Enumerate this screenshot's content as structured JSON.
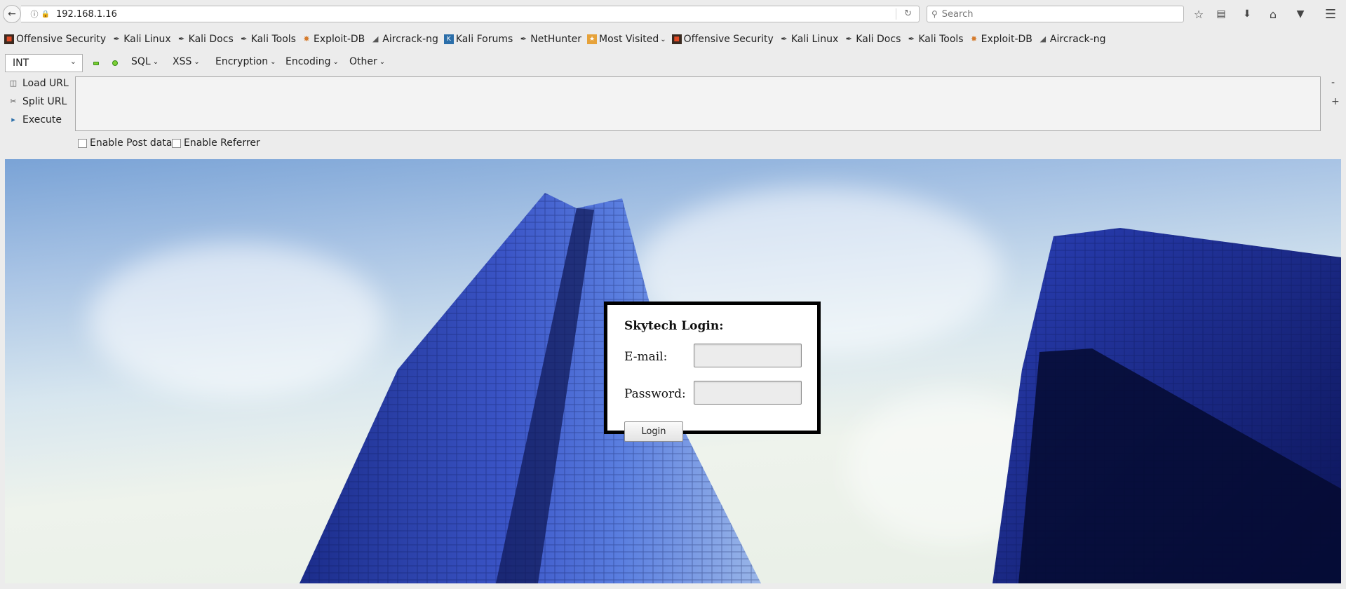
{
  "browser": {
    "url": "192.168.1.16",
    "search_placeholder": "Search",
    "icons": [
      "back-arrow-icon",
      "info-icon",
      "insecure-lock-icon",
      "reload-icon",
      "search-icon",
      "bookmark-star-icon",
      "reading-list-icon",
      "download-icon",
      "home-icon",
      "pocket-icon",
      "hamburger-menu-icon"
    ]
  },
  "bookmarks": [
    {
      "label": "Offensive Security",
      "icon": "offensive-security-icon"
    },
    {
      "label": "Kali Linux",
      "icon": "kali-dragon-icon"
    },
    {
      "label": "Kali Docs",
      "icon": "kali-dragon-icon"
    },
    {
      "label": "Kali Tools",
      "icon": "kali-dragon-icon"
    },
    {
      "label": "Exploit-DB",
      "icon": "exploit-db-icon"
    },
    {
      "label": "Aircrack-ng",
      "icon": "aircrack-icon"
    },
    {
      "label": "Kali Forums",
      "icon": "kali-forums-icon"
    },
    {
      "label": "NetHunter",
      "icon": "kali-dragon-icon"
    },
    {
      "label": "Most Visited",
      "icon": "most-visited-icon"
    },
    {
      "label": "Offensive Security",
      "icon": "offensive-security-icon"
    },
    {
      "label": "Kali Linux",
      "icon": "kali-dragon-icon"
    },
    {
      "label": "Kali Docs",
      "icon": "kali-dragon-icon"
    },
    {
      "label": "Kali Tools",
      "icon": "kali-dragon-icon"
    },
    {
      "label": "Exploit-DB",
      "icon": "exploit-db-icon"
    },
    {
      "label": "Aircrack-ng",
      "icon": "aircrack-icon"
    }
  ],
  "hackbar": {
    "select_value": "INT",
    "menus": [
      "SQL",
      "XSS",
      "Encryption",
      "Encoding",
      "Other"
    ],
    "load_url": "Load URL",
    "split_url": "Split URL",
    "execute": "Execute",
    "minus": "-",
    "plus": "+",
    "enable_post": "Enable Post data",
    "enable_referrer": "Enable Referrer",
    "accent_color": "#7ccf34"
  },
  "page": {
    "login_title": "Skytech Login:",
    "email_label": "E-mail:",
    "password_label": "Password:",
    "login_button": "Login",
    "email_value": "",
    "password_value": ""
  }
}
